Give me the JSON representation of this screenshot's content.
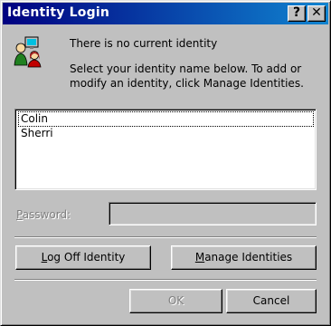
{
  "window": {
    "title": "Identity Login",
    "help_button": "?",
    "close_button": "✕"
  },
  "status_text": "There is no current identity",
  "instructions": "Select your identity name below.  To add or modify an identity, click Manage Identities.",
  "identities": [
    {
      "name": "Colin",
      "selected": true
    },
    {
      "name": "Sherri",
      "selected": false
    }
  ],
  "password": {
    "label_mnemonic": "P",
    "label_rest": "assword:",
    "value": ""
  },
  "buttons": {
    "log_off_mnemonic": "L",
    "log_off_rest": "og Off Identity",
    "manage_mnemonic": "M",
    "manage_rest": "anage Identities",
    "ok": "OK",
    "cancel": "Cancel"
  }
}
